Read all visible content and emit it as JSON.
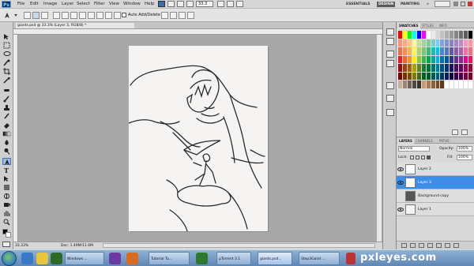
{
  "app": {
    "logo": "Ps"
  },
  "menu": [
    "File",
    "Edit",
    "Image",
    "Layer",
    "Select",
    "Filter",
    "View",
    "Window",
    "Help"
  ],
  "zoom_dropdown": "33.3",
  "workspaces": {
    "essentials": "ESSENTIALS",
    "design": "DESIGN",
    "painting": "PAINTING",
    "more": "»"
  },
  "options": {
    "auto_add_delete": "Auto Add/Delete"
  },
  "document": {
    "tab_title": "giants.psd @ 33.3% (Layer 3, RGB/8) *"
  },
  "status": {
    "zoom": "33.33%",
    "doc": "Doc: 1.49M/11.6M"
  },
  "swatches_panel": {
    "tabs": [
      "SWATCHES",
      "STYLES",
      "INFO"
    ],
    "colors_row1": [
      "#ff0000",
      "#ffff00",
      "#00ff00",
      "#00ffff",
      "#0000ff",
      "#ff00ff",
      "#ffffff",
      "#ebebeb",
      "#d6d6d6",
      "#c2c2c2",
      "#adadad",
      "#999999",
      "#858585",
      "#707070",
      "#5c5c5c",
      "#000000"
    ],
    "rows": [
      [
        "#f7977a",
        "#f9ad81",
        "#fdc68a",
        "#fff79a",
        "#c4df9b",
        "#a3d39c",
        "#82ca9d",
        "#7bcdc8",
        "#6ecff6",
        "#7ea7d8",
        "#8493ca",
        "#8882be",
        "#a187be",
        "#bc8dbf",
        "#f49ac2",
        "#f6989d"
      ],
      [
        "#f26c4f",
        "#f68e55",
        "#fbaf5c",
        "#fff467",
        "#acd372",
        "#7cc576",
        "#3bb878",
        "#1abbb4",
        "#00bff3",
        "#438ccb",
        "#5574b9",
        "#605ca8",
        "#855fa8",
        "#a763a8",
        "#f06eaa",
        "#f26d7d"
      ],
      [
        "#ed1c24",
        "#f26522",
        "#f7941d",
        "#fff200",
        "#8dc73f",
        "#39b54a",
        "#00a651",
        "#00a99d",
        "#00aeef",
        "#0072bc",
        "#0054a6",
        "#2e3192",
        "#662d91",
        "#92278f",
        "#ec008c",
        "#ed145b"
      ],
      [
        "#9e0b0f",
        "#a0410d",
        "#a36209",
        "#aba000",
        "#598527",
        "#1a7b30",
        "#007236",
        "#00746b",
        "#0076a3",
        "#004b80",
        "#003471",
        "#1b1464",
        "#440e62",
        "#630460",
        "#9e005d",
        "#9e0039"
      ],
      [
        "#790000",
        "#7b2e00",
        "#7d4900",
        "#827b00",
        "#406618",
        "#005e20",
        "#005826",
        "#005952",
        "#005b7f",
        "#003663",
        "#002157",
        "#0d004c",
        "#32004b",
        "#4b0049",
        "#7b0046",
        "#7a0026"
      ],
      [
        "#c7b299",
        "#998675",
        "#736357",
        "#534741",
        "#37302d",
        "#c69c6d",
        "#a67c52",
        "#8c6239",
        "#754c24",
        "#603913",
        "#ffffff",
        "#ffffff",
        "#ffffff",
        "#ffffff",
        "#ffffff",
        "#ffffff"
      ]
    ]
  },
  "layers_panel": {
    "tabs": [
      "LAYERS",
      "CHANNELS",
      "PATHS"
    ],
    "blend_mode": "Normal",
    "opacity_label": "Opacity:",
    "opacity_value": "100%",
    "lock_label": "Lock:",
    "fill_label": "Fill:",
    "fill_value": "100%",
    "layers": [
      {
        "name": "Layer 2",
        "visible": true,
        "selected": false,
        "thumb": "#ffffff"
      },
      {
        "name": "Layer 3",
        "visible": true,
        "selected": true,
        "thumb": "#ffffff"
      },
      {
        "name": "Background copy",
        "visible": false,
        "selected": false,
        "thumb": "#555555"
      },
      {
        "name": "Layer 1",
        "visible": true,
        "selected": false,
        "thumb": "#f4f4f4"
      }
    ]
  },
  "taskbar": {
    "items": [
      {
        "label": "Windows ..."
      },
      {
        "label": "Tutorial Tu..."
      },
      {
        "label": "µTorrent 3.1"
      },
      {
        "label": "giants.psd..."
      },
      {
        "label": "Step3Gaint ..."
      }
    ]
  },
  "watermark": "pxleyes.com",
  "colors": {
    "accent_selected": "#3d8ee8",
    "menu_bg": "#d6d6d6",
    "workspace_bg": "#a8a8a8"
  }
}
